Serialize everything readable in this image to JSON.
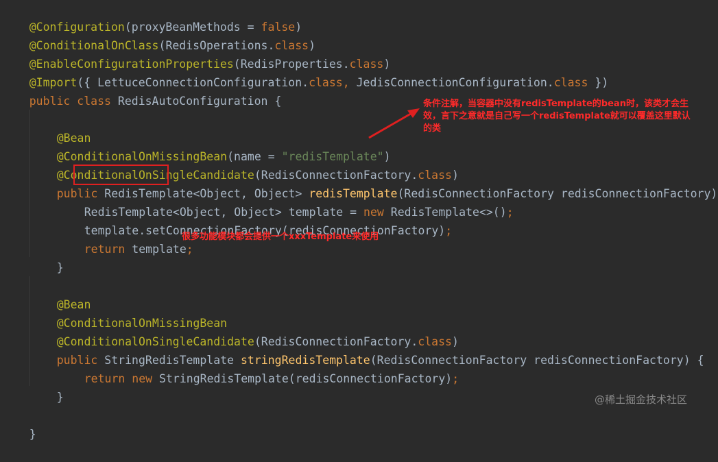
{
  "code": {
    "l1": {
      "ann": "@Configuration",
      "open": "(",
      "param": "proxyBeanMethods = ",
      "val": "false",
      "close": ")"
    },
    "l2": {
      "ann": "@ConditionalOnClass",
      "open": "(",
      "type": "RedisOperations.",
      "cls": "class",
      "close": ")"
    },
    "l3": {
      "ann": "@EnableConfigurationProperties",
      "open": "(",
      "type": "RedisProperties.",
      "cls": "class",
      "close": ")"
    },
    "l4": {
      "ann": "@Import",
      "open": "({ ",
      "t1": "LettuceConnectionConfiguration.",
      "c1": "class",
      "comma": ", ",
      "t2": "JedisConnectionConfiguration.",
      "c2": "class",
      "close": " })"
    },
    "l5": {
      "kw": "public class ",
      "name": "RedisAutoConfiguration ",
      "brace": "{"
    },
    "l7": {
      "ann": "@Bean"
    },
    "l8": {
      "ann": "@ConditionalOnMissingBean",
      "open": "(",
      "param": "name = ",
      "str": "\"redisTemplate\"",
      "close": ")"
    },
    "l9": {
      "ann": "@ConditionalOnSingleCandidate",
      "open": "(",
      "type": "RedisConnectionFactory.",
      "cls": "class",
      "close": ")"
    },
    "l10": {
      "kw": "public ",
      "ret": "RedisTemplate",
      "gen": "<Object, Object> ",
      "fn": "redisTemplate",
      "params": "(RedisConnectionFactory redisConnectionFactory) ",
      "brace": "{"
    },
    "l11": {
      "type": "RedisTemplate<Object, Object> template = ",
      "kw": "new ",
      "ctor": "RedisTemplate<>()",
      "semi": ";"
    },
    "l12": {
      "call": "template.setConnectionFactory(redisConnectionFactory)",
      "semi": ";"
    },
    "l13": {
      "kw": "return ",
      "val": "template",
      "semi": ";"
    },
    "l14": {
      "brace": "}"
    },
    "l16": {
      "ann": "@Bean"
    },
    "l17": {
      "ann": "@ConditionalOnMissingBean"
    },
    "l18": {
      "ann": "@ConditionalOnSingleCandidate",
      "open": "(",
      "type": "RedisConnectionFactory.",
      "cls": "class",
      "close": ")"
    },
    "l19": {
      "kw": "public ",
      "ret": "StringRedisTemplate ",
      "fn": "stringRedisTemplate",
      "params": "(RedisConnectionFactory redisConnectionFactory) ",
      "brace": "{"
    },
    "l20": {
      "kw": "return ",
      "kw2": "new ",
      "call": "StringRedisTemplate(redisConnectionFactory)",
      "semi": ";"
    },
    "l21": {
      "brace": "}"
    },
    "l23": {
      "brace": "}"
    }
  },
  "annotations": {
    "note1": "条件注解，当容器中没有redisTemplate的bean时，该类才会生效，言下之意就是自己写一个redisTemplate就可以覆盖这里默认的类",
    "note2": "很多功能模块都会提供一个xxxTemplate来使用"
  },
  "watermark": "@稀土掘金技术社区",
  "colors": {
    "background": "#2b2b2b",
    "annotation": "#bbb529",
    "keyword": "#cc7832",
    "string": "#6a8759",
    "method": "#ffc66d",
    "plain": "#a9b7c6",
    "note": "#ff2a2a",
    "highlight_box": "#e02020"
  }
}
